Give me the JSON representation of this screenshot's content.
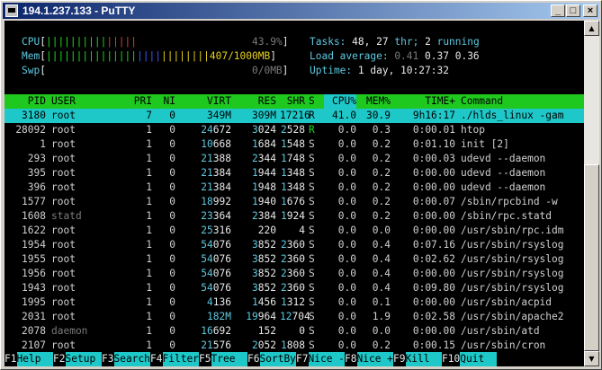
{
  "window": {
    "title": "194.1.237.133 - PuTTY",
    "minimize": "_",
    "maximize": "□",
    "close": "×"
  },
  "meters": {
    "cpu": {
      "label": "CPU",
      "bar_red": "|||||||||||||||",
      "bar_green": "",
      "value": "43.9%"
    },
    "mem": {
      "label": "Mem",
      "bar": "|||||||||||||||||||||||||||",
      "value": "407/1000MB"
    },
    "swp": {
      "label": "Swp",
      "value": "0/0MB"
    }
  },
  "stats": {
    "tasks_label": "Tasks:",
    "tasks": "48,",
    "thr": "27",
    "thr_label": "thr;",
    "running": "2",
    "running_label": "running",
    "load_label": "Load average:",
    "load1": "0.41",
    "load5": "0.37",
    "load15": "0.36",
    "uptime_label": "Uptime:",
    "uptime": "1 day, 10:27:32"
  },
  "columns": [
    "PID",
    "USER",
    "PRI",
    "NI",
    "VIRT",
    "RES",
    "SHR",
    "S",
    "CPU%",
    "MEM%",
    "TIME+",
    "Command"
  ],
  "processes": [
    {
      "pid": "3180",
      "user": "root",
      "pri": "7",
      "ni": "0",
      "virt": "349M",
      "res": "309M",
      "shr": "17216",
      "s": "R",
      "cpu": "41.0",
      "mem": "30.9",
      "time": "9h16:17",
      "cmd": "./hlds_linux -gam"
    },
    {
      "pid": "28092",
      "user": "root",
      "pri": "1",
      "ni": "0",
      "virt": "24672",
      "res": "3024",
      "shr": "2528",
      "s": "R",
      "cpu": "0.0",
      "mem": "0.3",
      "time": "0:00.01",
      "cmd": "htop"
    },
    {
      "pid": "1",
      "user": "root",
      "pri": "1",
      "ni": "0",
      "virt": "10668",
      "res": "1684",
      "shr": "1548",
      "s": "S",
      "cpu": "0.0",
      "mem": "0.2",
      "time": "0:01.10",
      "cmd": "init [2]"
    },
    {
      "pid": "293",
      "user": "root",
      "pri": "1",
      "ni": "0",
      "virt": "21388",
      "res": "2344",
      "shr": "1748",
      "s": "S",
      "cpu": "0.0",
      "mem": "0.2",
      "time": "0:00.03",
      "cmd": "udevd --daemon"
    },
    {
      "pid": "395",
      "user": "root",
      "pri": "1",
      "ni": "0",
      "virt": "21384",
      "res": "1944",
      "shr": "1348",
      "s": "S",
      "cpu": "0.0",
      "mem": "0.2",
      "time": "0:00.00",
      "cmd": "udevd --daemon"
    },
    {
      "pid": "396",
      "user": "root",
      "pri": "1",
      "ni": "0",
      "virt": "21384",
      "res": "1948",
      "shr": "1348",
      "s": "S",
      "cpu": "0.0",
      "mem": "0.2",
      "time": "0:00.00",
      "cmd": "udevd --daemon"
    },
    {
      "pid": "1577",
      "user": "root",
      "pri": "1",
      "ni": "0",
      "virt": "18992",
      "res": "1940",
      "shr": "1676",
      "s": "S",
      "cpu": "0.0",
      "mem": "0.2",
      "time": "0:00.07",
      "cmd": "/sbin/rpcbind -w"
    },
    {
      "pid": "1608",
      "user": "statd",
      "pri": "1",
      "ni": "0",
      "virt": "23364",
      "res": "2384",
      "shr": "1924",
      "s": "S",
      "cpu": "0.0",
      "mem": "0.2",
      "time": "0:00.00",
      "cmd": "/sbin/rpc.statd"
    },
    {
      "pid": "1622",
      "user": "root",
      "pri": "1",
      "ni": "0",
      "virt": "25316",
      "res": "220",
      "shr": "4",
      "s": "S",
      "cpu": "0.0",
      "mem": "0.0",
      "time": "0:00.00",
      "cmd": "/usr/sbin/rpc.idm"
    },
    {
      "pid": "1954",
      "user": "root",
      "pri": "1",
      "ni": "0",
      "virt": "54076",
      "res": "3852",
      "shr": "2360",
      "s": "S",
      "cpu": "0.0",
      "mem": "0.4",
      "time": "0:07.16",
      "cmd": "/usr/sbin/rsyslog"
    },
    {
      "pid": "1955",
      "user": "root",
      "pri": "1",
      "ni": "0",
      "virt": "54076",
      "res": "3852",
      "shr": "2360",
      "s": "S",
      "cpu": "0.0",
      "mem": "0.4",
      "time": "0:02.62",
      "cmd": "/usr/sbin/rsyslog"
    },
    {
      "pid": "1956",
      "user": "root",
      "pri": "1",
      "ni": "0",
      "virt": "54076",
      "res": "3852",
      "shr": "2360",
      "s": "S",
      "cpu": "0.0",
      "mem": "0.4",
      "time": "0:00.00",
      "cmd": "/usr/sbin/rsyslog"
    },
    {
      "pid": "1943",
      "user": "root",
      "pri": "1",
      "ni": "0",
      "virt": "54076",
      "res": "3852",
      "shr": "2360",
      "s": "S",
      "cpu": "0.0",
      "mem": "0.4",
      "time": "0:09.80",
      "cmd": "/usr/sbin/rsyslog"
    },
    {
      "pid": "1995",
      "user": "root",
      "pri": "1",
      "ni": "0",
      "virt": "4136",
      "res": "1456",
      "shr": "1312",
      "s": "S",
      "cpu": "0.0",
      "mem": "0.1",
      "time": "0:00.00",
      "cmd": "/usr/sbin/acpid"
    },
    {
      "pid": "2031",
      "user": "root",
      "pri": "1",
      "ni": "0",
      "virt": "182M",
      "res": "19964",
      "shr": "12704",
      "s": "S",
      "cpu": "0.0",
      "mem": "1.9",
      "time": "0:02.58",
      "cmd": "/usr/sbin/apache2"
    },
    {
      "pid": "2078",
      "user": "daemon",
      "pri": "1",
      "ni": "0",
      "virt": "16692",
      "res": "152",
      "shr": "0",
      "s": "S",
      "cpu": "0.0",
      "mem": "0.0",
      "time": "0:00.00",
      "cmd": "/usr/sbin/atd"
    },
    {
      "pid": "2107",
      "user": "root",
      "pri": "1",
      "ni": "0",
      "virt": "21576",
      "res": "2052",
      "shr": "1808",
      "s": "S",
      "cpu": "0.0",
      "mem": "0.2",
      "time": "0:00.15",
      "cmd": "/usr/sbin/cron"
    }
  ],
  "fkeys": [
    {
      "key": "F1",
      "label": "Help  "
    },
    {
      "key": "F2",
      "label": "Setup "
    },
    {
      "key": "F3",
      "label": "Search"
    },
    {
      "key": "F4",
      "label": "Filter"
    },
    {
      "key": "F5",
      "label": "Tree  "
    },
    {
      "key": "F6",
      "label": "SortBy"
    },
    {
      "key": "F7",
      "label": "Nice -"
    },
    {
      "key": "F8",
      "label": "Nice +"
    },
    {
      "key": "F9",
      "label": "Kill  "
    },
    {
      "key": "F10",
      "label": "Quit  "
    }
  ],
  "colors": {
    "header_bg": "#1ec81e",
    "selected_bg": "#1ec8c8",
    "cyan": "#5ec8e0",
    "titlebar": "#0a246a"
  }
}
